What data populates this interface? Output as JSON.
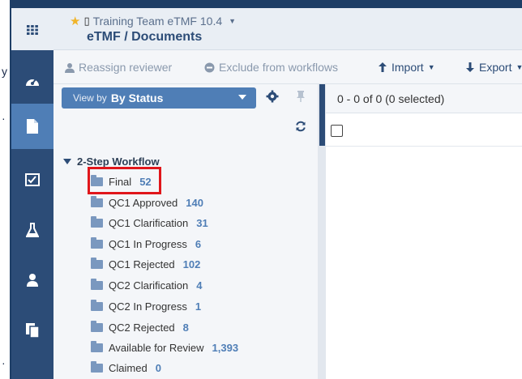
{
  "header": {
    "app_name": "Training Team eTMF 10.4",
    "title": "eTMF / Documents"
  },
  "toolbar": {
    "reassign_label": "Reassign reviewer",
    "exclude_label": "Exclude from workflows",
    "import_label": "Import",
    "export_label": "Export"
  },
  "nav": {
    "icons": [
      "grid-icon",
      "dashboard-icon",
      "document-icon",
      "checklist-icon",
      "flask-icon",
      "user-icon",
      "copy-icon"
    ],
    "active": "document-icon"
  },
  "panel": {
    "view_by_prefix": "View by",
    "view_by_value": "By Status",
    "group": {
      "label": "2-Step Workflow",
      "items": [
        {
          "label": "Final",
          "count": "52"
        },
        {
          "label": "QC1 Approved",
          "count": "140"
        },
        {
          "label": "QC1 Clarification",
          "count": "31"
        },
        {
          "label": "QC1 In Progress",
          "count": "6"
        },
        {
          "label": "QC1 Rejected",
          "count": "102"
        },
        {
          "label": "QC2 Clarification",
          "count": "4"
        },
        {
          "label": "QC2 In Progress",
          "count": "1"
        },
        {
          "label": "QC2 Rejected",
          "count": "8"
        },
        {
          "label": "Available for Review",
          "count": "1,393"
        },
        {
          "label": "Claimed",
          "count": "0"
        }
      ]
    }
  },
  "grid": {
    "count_text": "0 - 0 of 0 (0 selected)"
  },
  "colors": {
    "nav_bg": "#2c4c77",
    "accent": "#4f7eb6",
    "highlight": "#e0161b"
  }
}
